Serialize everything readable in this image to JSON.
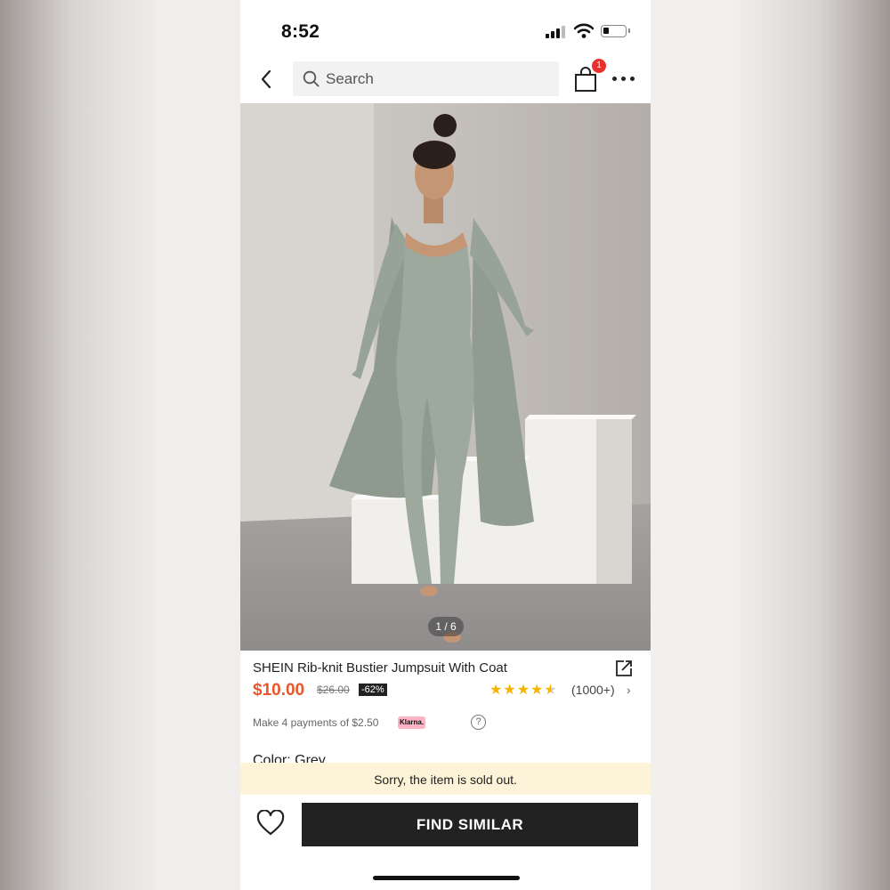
{
  "status_bar": {
    "time": "8:52"
  },
  "header": {
    "search_placeholder": "Search",
    "cart_count": "1"
  },
  "gallery": {
    "counter": "1 / 6"
  },
  "product": {
    "title": "SHEIN Rib-knit Bustier Jumpsuit With Coat",
    "price": "$10.00",
    "original_price": "$26.00",
    "discount": "-62%",
    "rating": 4.5,
    "reviews": "(1000+)",
    "installments": "Make 4 payments of $2.50",
    "klarna_logo": "Klarna.",
    "color_label": "Color: Grey"
  },
  "notice": {
    "sold_out": "Sorry, the item is sold out."
  },
  "actions": {
    "find_similar": "FIND SIMILAR"
  },
  "colors": {
    "price": "#e8562a",
    "badge": "#e8302f",
    "star": "#f5b400",
    "notice_bg": "#fdf3d8"
  }
}
